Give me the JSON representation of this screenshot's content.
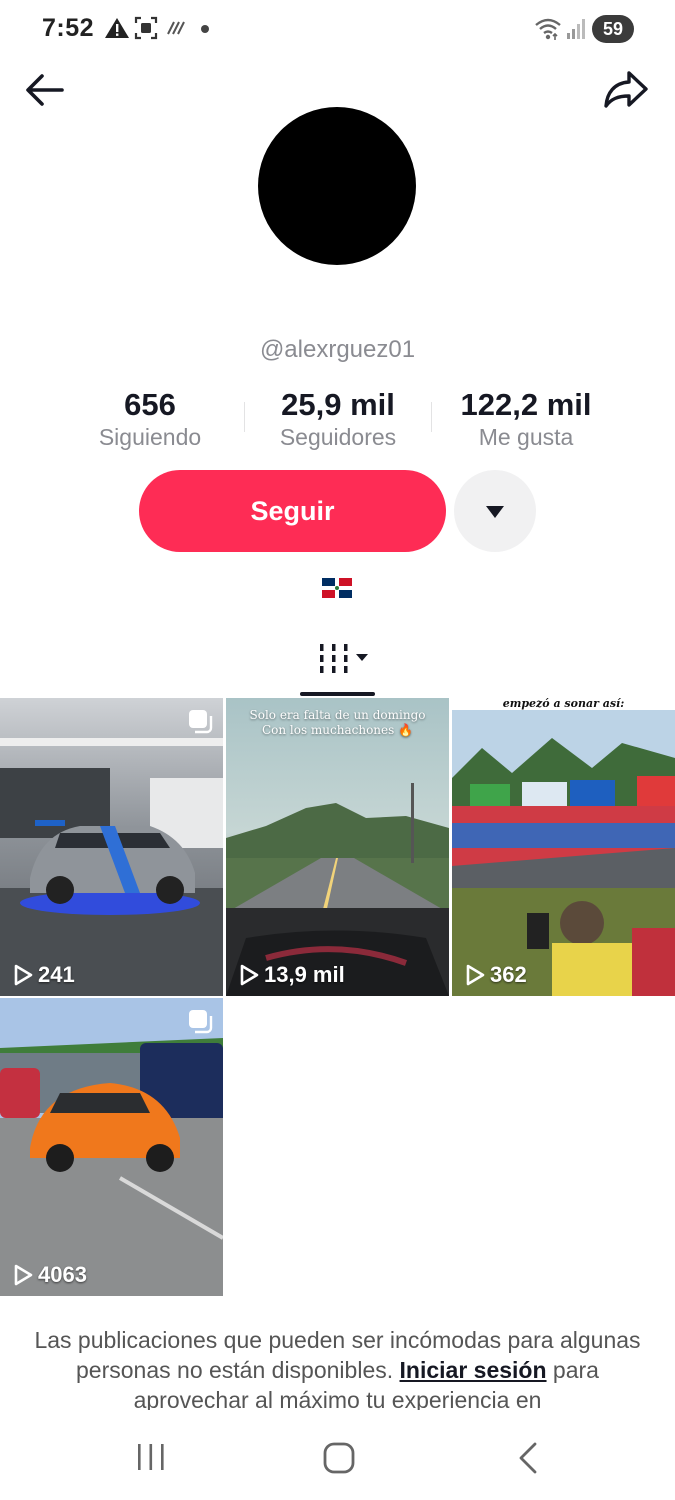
{
  "status_bar": {
    "time": "7:52",
    "battery": "59",
    "icons": [
      "warning-icon",
      "screenshot-icon",
      "nfc-icon",
      "dot-icon",
      "wifi-icon",
      "signal-icon"
    ]
  },
  "header": {
    "back_icon": "arrow-left-icon",
    "share_icon": "share-icon"
  },
  "profile": {
    "username": "@alexrguez01",
    "stats": [
      {
        "value": "656",
        "label": "Siguiendo"
      },
      {
        "value": "25,9 mil",
        "label": "Seguidores"
      },
      {
        "value": "122,2 mil",
        "label": "Me gusta"
      }
    ],
    "follow_label": "Seguir",
    "flag": "dominican-republic-flag"
  },
  "tabs": {
    "active_icon": "grid-icon"
  },
  "videos": [
    {
      "views": "241",
      "caption": ""
    },
    {
      "views": "13,9 mil",
      "caption": "Solo era falta de un domingo\nCon los muchachones 🔥"
    },
    {
      "views": "362",
      "caption": "empezó a sonar así:"
    },
    {
      "views": "4063",
      "caption": ""
    }
  ],
  "notice": {
    "text_before": "Las publicaciones que pueden ser incómodas para algunas personas no están disponibles. ",
    "link": "Iniciar sesión",
    "text_after": " para aprovechar al máximo tu experiencia en"
  },
  "colors": {
    "accent": "#fe2c55",
    "text": "#161823",
    "muted": "#8a8b91"
  }
}
